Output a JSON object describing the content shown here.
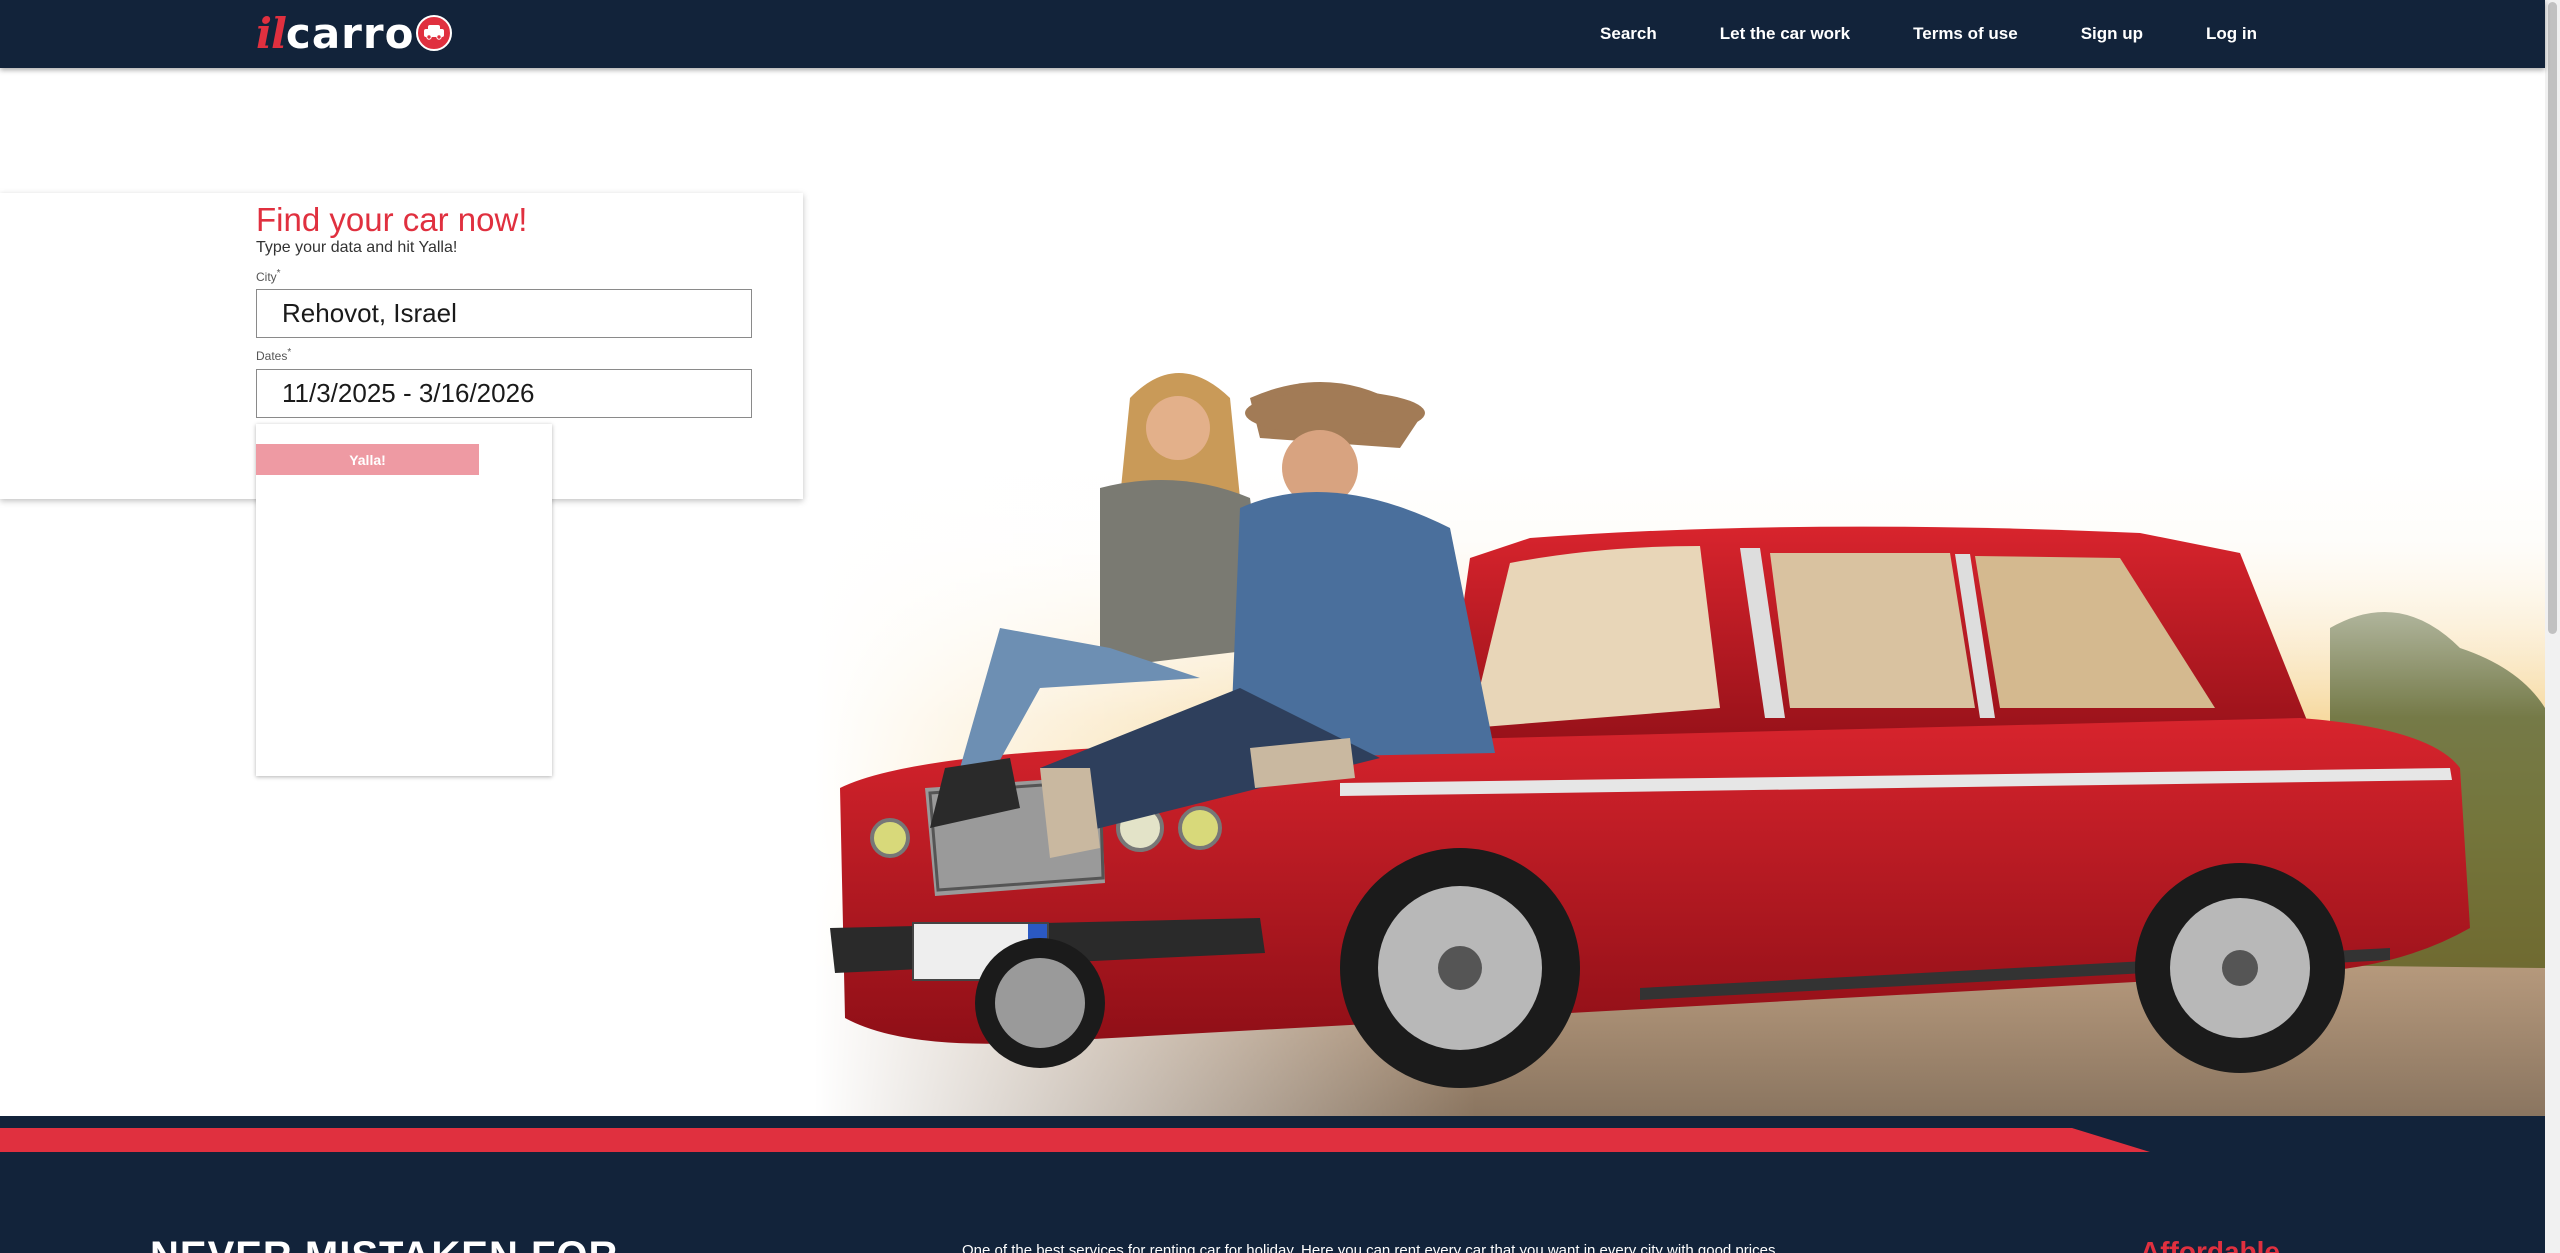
{
  "header": {
    "logo": {
      "prefix": "il",
      "name": "carro"
    },
    "nav": [
      "Search",
      "Let the car work",
      "Terms of use",
      "Sign up",
      "Log in"
    ]
  },
  "search_form": {
    "title": "Find your car now!",
    "subtitle": "Type your data and hit Yalla!",
    "city": {
      "label": "City",
      "required_mark": "*",
      "value": "Rehovot, Israel"
    },
    "dates": {
      "label": "Dates",
      "required_mark": "*",
      "value": "11/3/2025 - 3/16/2026"
    },
    "submit_label": "Yalla!"
  },
  "footer": {
    "headline": "NEVER MISTAKEN FOR",
    "text": "One of the best services for renting car for holiday. Here you can rent every car that you want in every city with good prices",
    "right_heading": "Affordable"
  },
  "colors": {
    "navy": "#12233a",
    "brand_red": "#e0303f",
    "button_disabled": "#ee9aa3",
    "car_red": "#c41a22"
  },
  "icons": [
    "car-badge-icon"
  ]
}
